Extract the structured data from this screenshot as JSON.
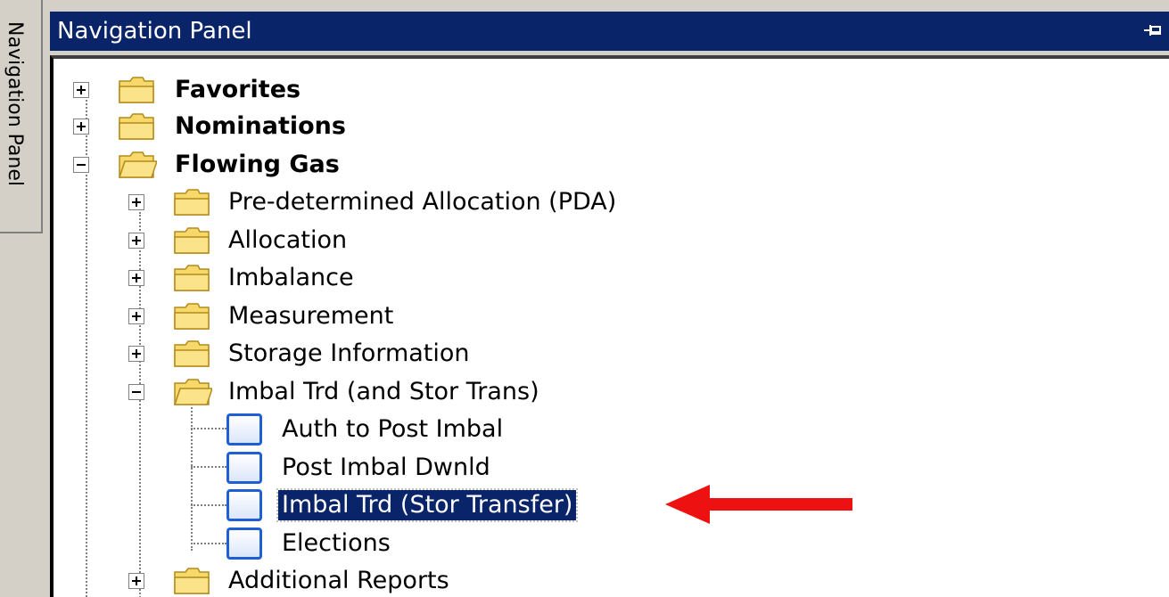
{
  "side_tab": {
    "label": "Navigation Panel"
  },
  "header": {
    "title": "Navigation Panel",
    "pin_icon": "pin-icon"
  },
  "tree": {
    "favorites": "Favorites",
    "nominations": "Nominations",
    "flowing_gas": "Flowing Gas",
    "pda": "Pre-determined Allocation (PDA)",
    "allocation": "Allocation",
    "imbalance": "Imbalance",
    "measurement": "Measurement",
    "storage_information": "Storage Information",
    "imbal_trd": "Imbal Trd (and Stor Trans)",
    "auth_to_post": "Auth to Post Imbal",
    "post_imbal_dwnld": "Post Imbal Dwnld",
    "imbal_trd_stor_transfer": "Imbal Trd (Stor Transfer)",
    "elections": "Elections",
    "additional_reports": "Additional Reports"
  },
  "colors": {
    "header_bg": "#0a246a",
    "selection_bg": "#0a246a",
    "arrow": "#ee1111"
  }
}
